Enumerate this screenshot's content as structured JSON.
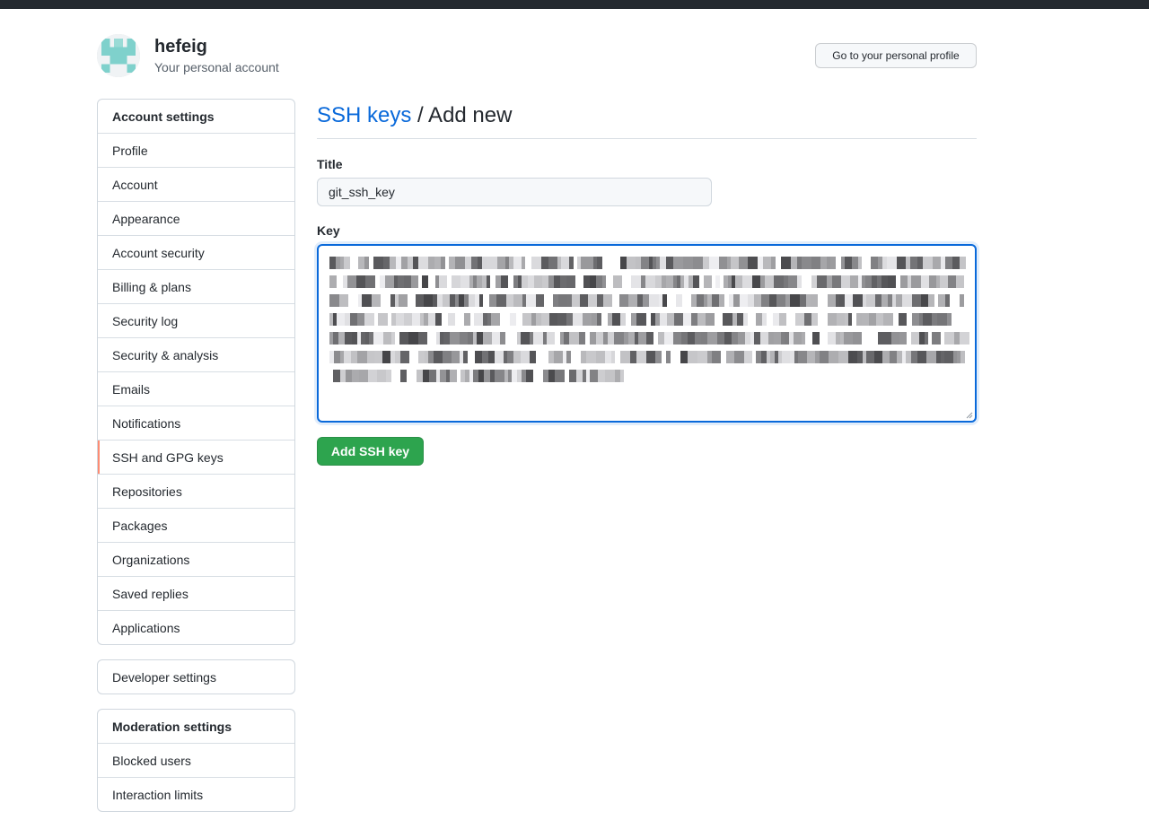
{
  "header": {
    "username": "hefeig",
    "subtitle": "Your personal account",
    "profile_button": "Go to your personal profile"
  },
  "sidebar": {
    "account_settings": {
      "heading": "Account settings",
      "items": [
        {
          "label": "Profile"
        },
        {
          "label": "Account"
        },
        {
          "label": "Appearance"
        },
        {
          "label": "Account security"
        },
        {
          "label": "Billing & plans"
        },
        {
          "label": "Security log"
        },
        {
          "label": "Security & analysis"
        },
        {
          "label": "Emails"
        },
        {
          "label": "Notifications"
        },
        {
          "label": "SSH and GPG keys",
          "selected": true
        },
        {
          "label": "Repositories"
        },
        {
          "label": "Packages"
        },
        {
          "label": "Organizations"
        },
        {
          "label": "Saved replies"
        },
        {
          "label": "Applications"
        }
      ]
    },
    "developer": {
      "label": "Developer settings"
    },
    "moderation": {
      "heading": "Moderation settings",
      "items": [
        {
          "label": "Blocked users"
        },
        {
          "label": "Interaction limits"
        }
      ]
    }
  },
  "main": {
    "breadcrumb_link": "SSH keys",
    "breadcrumb_rest": " / Add new",
    "title_label": "Title",
    "title_value": "git_ssh_key",
    "key_label": "Key",
    "key_value_obscured": true,
    "submit_label": "Add SSH key"
  },
  "colors": {
    "link": "#0969da",
    "primary_button": "#2da44e",
    "selected_marker": "#fd8c73",
    "focus_border": "#0969da"
  },
  "icons": {
    "avatar": "identicon"
  }
}
